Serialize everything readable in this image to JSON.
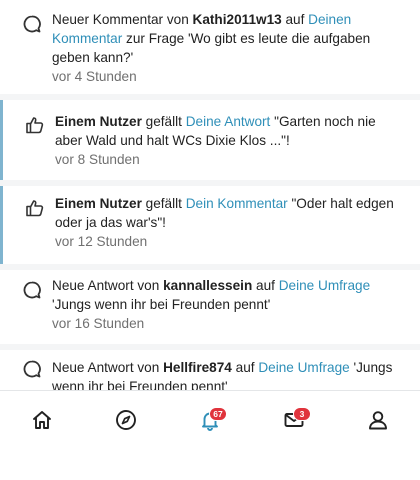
{
  "notifications": [
    {
      "type": "comment",
      "parts": [
        "Neuer Kommentar von ",
        "Kathi2011w13",
        " auf ",
        "Deinen Kommentar",
        " zur Frage 'Wo gibt es leute die aufgaben geben kann?'"
      ],
      "time": "vor 4 Stunden"
    },
    {
      "type": "like",
      "parts": [
        "Einem Nutzer",
        " gefällt ",
        "Deine Antwort",
        " \"Garten noch nie aber Wald und halt WCs Dixie Klos ...\"!"
      ],
      "time": "vor 8 Stunden"
    },
    {
      "type": "like",
      "parts": [
        "Einem Nutzer",
        " gefällt ",
        "Dein Kommentar",
        " \"Oder halt edgen oder ja das war's\"!"
      ],
      "time": "vor 12 Stunden"
    },
    {
      "type": "answer",
      "parts": [
        "Neue Antwort von ",
        "kannallessein",
        " auf ",
        "Deine Umfrage",
        " 'Jungs wenn ihr bei Freunden pennt'"
      ],
      "time": "vor 16 Stunden"
    },
    {
      "type": "answer",
      "parts": [
        "Neue Antwort von ",
        "Hellfire874",
        " auf ",
        "Deine Umfrage",
        " 'Jungs wenn ihr bei Freunden pennt'"
      ],
      "time": ""
    }
  ],
  "nav": {
    "home_icon": "home-icon",
    "explore_icon": "compass-icon",
    "notifications_icon": "bell-icon",
    "notifications_badge": "67",
    "messages_icon": "envelope-icon",
    "messages_badge": "3",
    "profile_icon": "user-icon"
  },
  "colors": {
    "link": "#2f8fb8",
    "unread_bar": "#7fb4cf",
    "badge": "#e0333c",
    "text": "#222222",
    "muted": "#707070"
  }
}
